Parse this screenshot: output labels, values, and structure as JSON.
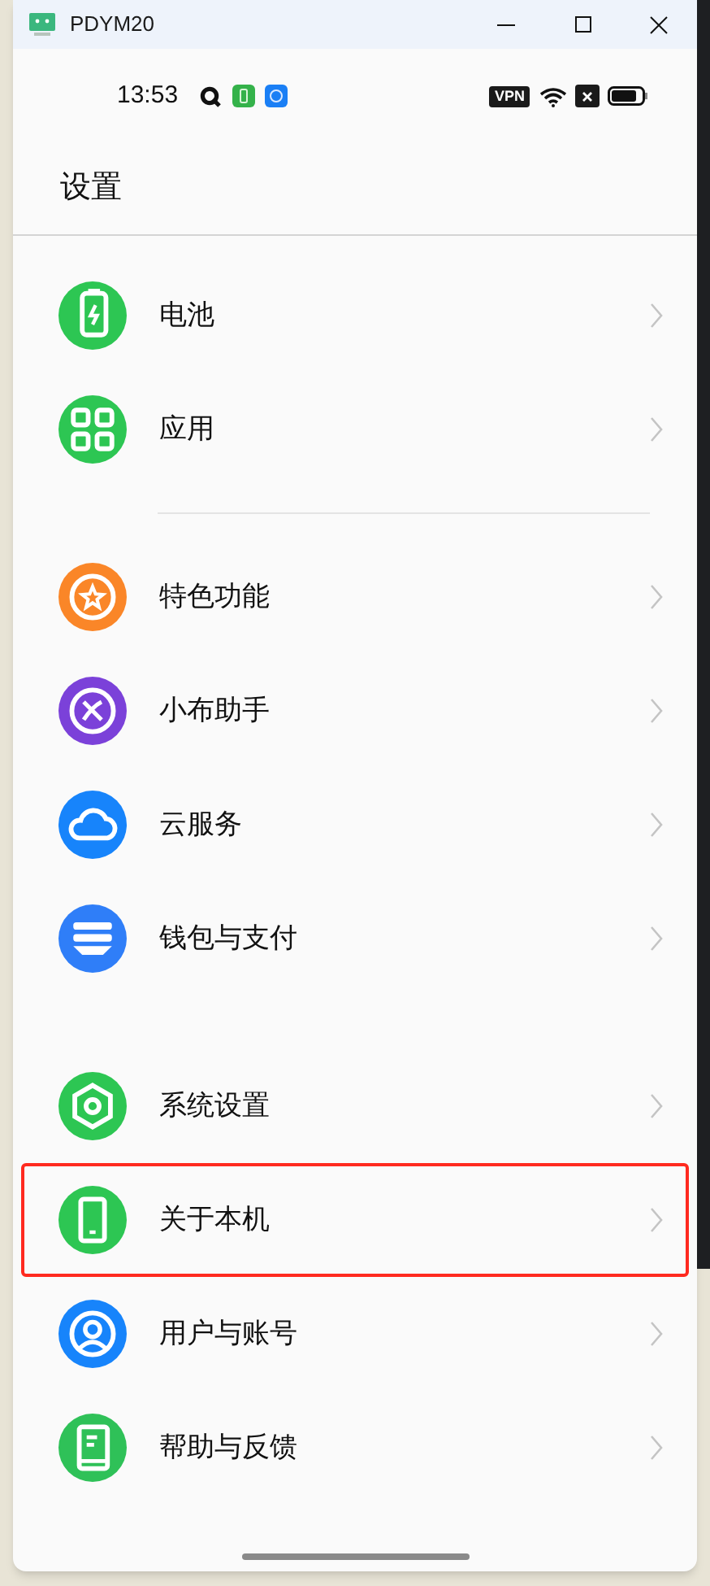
{
  "window": {
    "title": "PDYM20"
  },
  "status_bar": {
    "time": "13:53",
    "vpn": "VPN"
  },
  "page_title": "设置",
  "groups": [
    {
      "items": [
        {
          "label": "电池",
          "kind": "battery",
          "color": "#2dc653",
          "highlighted": false
        },
        {
          "label": "应用",
          "kind": "grid",
          "color": "#2dc653",
          "highlighted": false
        }
      ]
    },
    {
      "items": [
        {
          "label": "特色功能",
          "kind": "star",
          "color": "#fa8628",
          "highlighted": false
        },
        {
          "label": "小布助手",
          "kind": "assistant",
          "color": "#7b41d9",
          "highlighted": false
        },
        {
          "label": "云服务",
          "kind": "cloud",
          "color": "#1784fb",
          "highlighted": false
        },
        {
          "label": "钱包与支付",
          "kind": "wallet",
          "color": "#2f7ef8",
          "highlighted": false
        }
      ]
    },
    {
      "items": [
        {
          "label": "系统设置",
          "kind": "hexagon",
          "color": "#2dc653",
          "highlighted": false
        },
        {
          "label": "关于本机",
          "kind": "phone",
          "color": "#2dc653",
          "highlighted": true
        },
        {
          "label": "用户与账号",
          "kind": "user",
          "color": "#1784fb",
          "highlighted": false
        },
        {
          "label": "帮助与反馈",
          "kind": "book",
          "color": "#2fc158",
          "highlighted": false
        }
      ]
    }
  ]
}
